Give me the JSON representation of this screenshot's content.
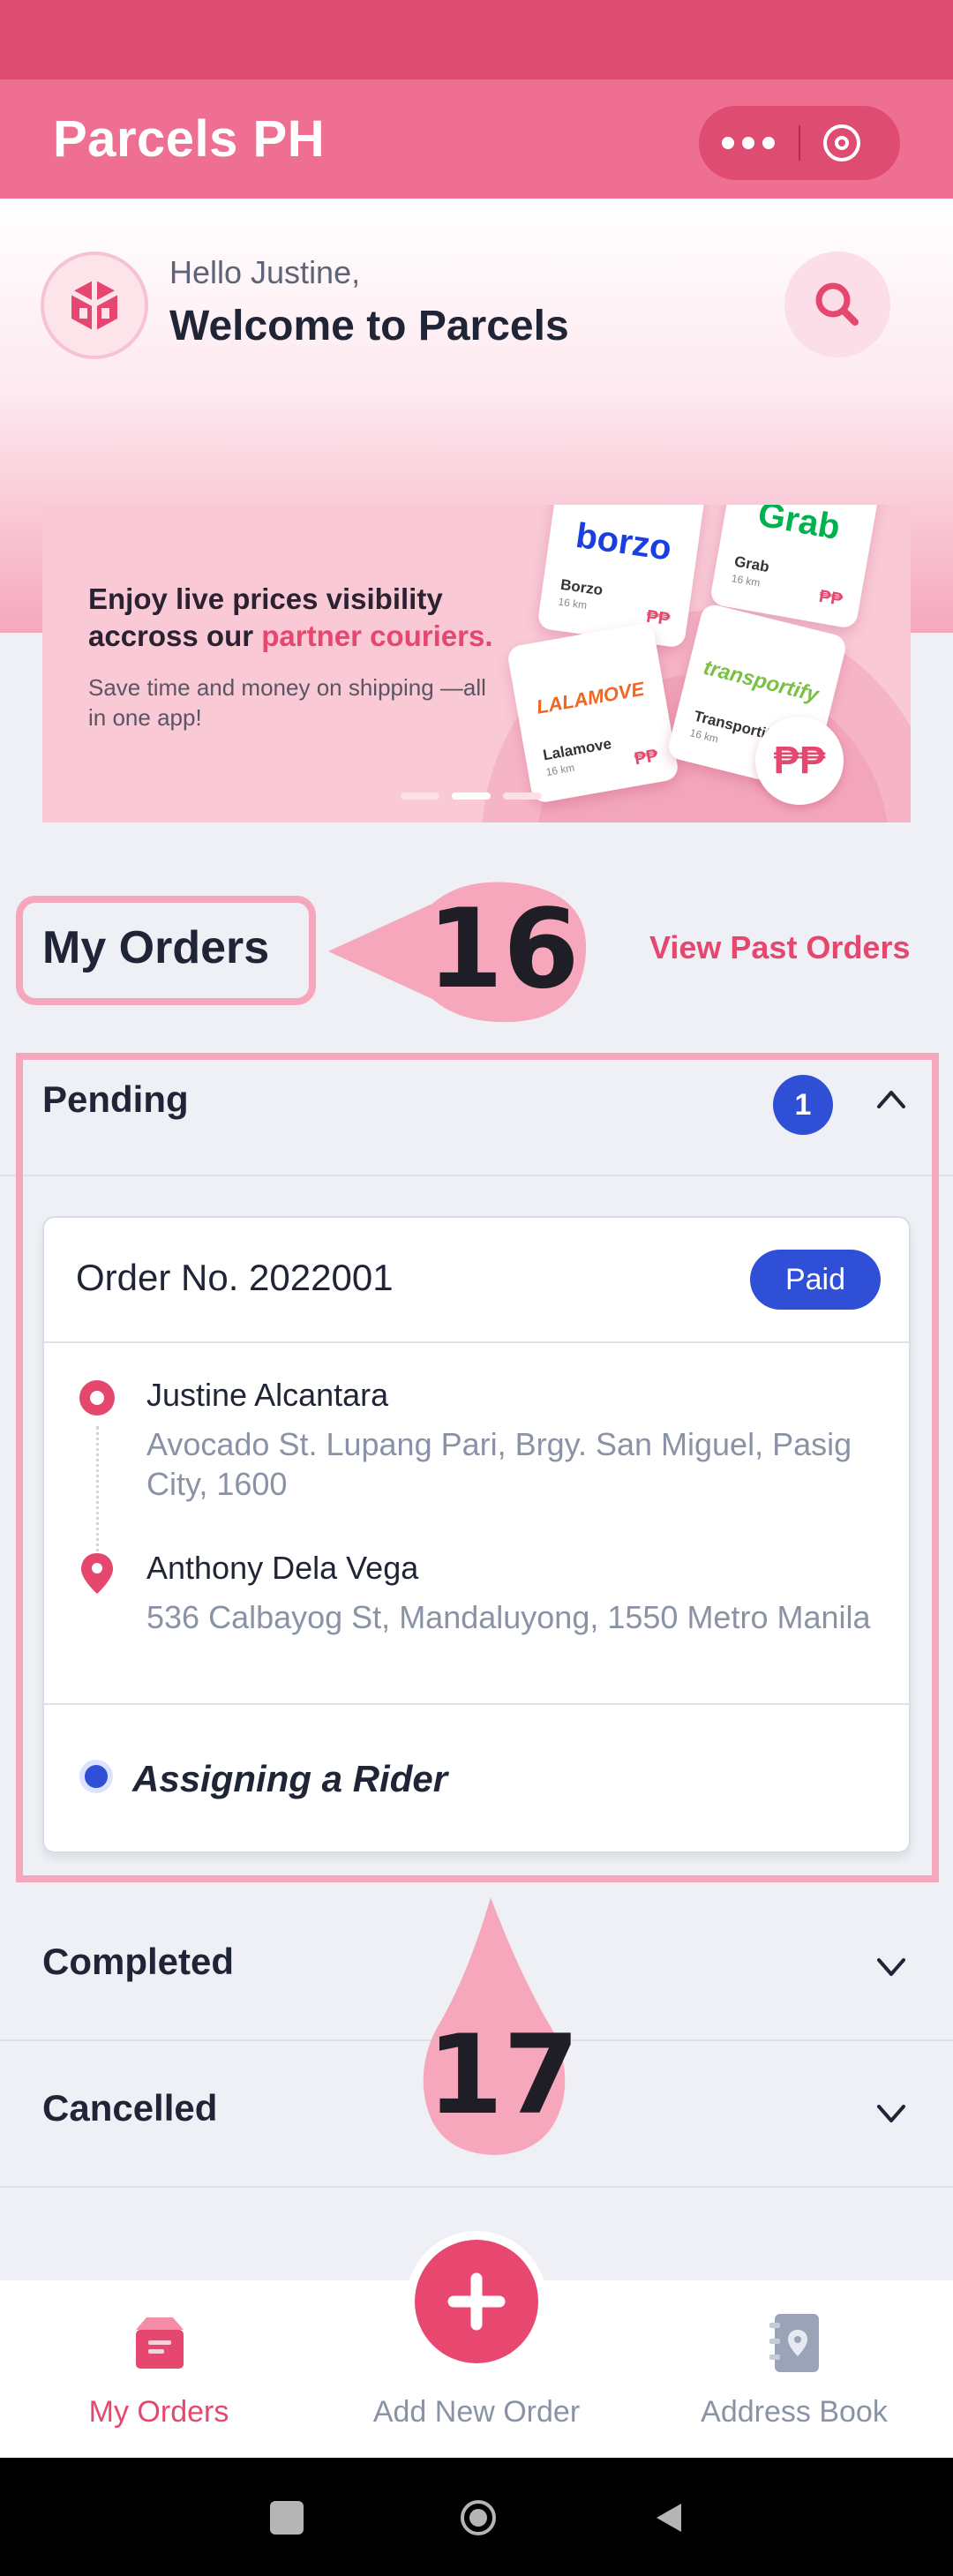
{
  "app": {
    "title": "Parcels PH"
  },
  "colors": {
    "primary": "#e5476f",
    "appbar": "#ef6f92",
    "statusbar": "#de4c72",
    "accent_blue": "#2f4fd6"
  },
  "header_icons": {
    "more": "more-horizontal-icon",
    "close": "close-circle-icon"
  },
  "welcome": {
    "greeting": "Hello Justine,",
    "title": "Welcome to Parcels"
  },
  "banner": {
    "headline_1": "Enjoy live prices visibility",
    "headline_2": "accross our ",
    "headline_highlight": "partner couriers.",
    "subtext": "Save time and money on shipping —all in one app!",
    "slides_total": 3,
    "slide_active": 2,
    "couriers": [
      {
        "logo": "borzo",
        "name": "Borzo",
        "distance": "16 km",
        "price_symbol": "₱₱"
      },
      {
        "logo": "Grab",
        "name": "Grab",
        "distance": "16 km",
        "price_symbol": "₱₱"
      },
      {
        "logo": "LALAMOVE",
        "name": "Lalamove",
        "distance": "16 km",
        "price_symbol": "₱₱"
      },
      {
        "logo": "transportify",
        "name": "Transportify",
        "distance": "16 km",
        "price_symbol": "₱₱"
      }
    ],
    "badge": "₱₱"
  },
  "orders": {
    "title": "My Orders",
    "view_past": "View Past Orders",
    "annotation_16": "16",
    "annotation_17": "17",
    "pending": {
      "label": "Pending",
      "count": "1",
      "expanded": true,
      "order": {
        "number": "Order No. 2022001",
        "payment_status": "Paid",
        "sender_name": "Justine Alcantara",
        "sender_address": "Avocado St. Lupang Pari, Brgy. San Miguel, Pasig City, 1600",
        "receiver_name": "Anthony Dela Vega",
        "receiver_address": "536 Calbayog St, Mandaluyong, 1550 Metro Manila",
        "status": "Assigning a Rider"
      }
    },
    "completed": {
      "label": "Completed"
    },
    "cancelled": {
      "label": "Cancelled"
    }
  },
  "bottom_nav": {
    "my_orders": "My Orders",
    "add_new_order": "Add New Order",
    "address_book": "Address Book",
    "active": "my_orders"
  }
}
